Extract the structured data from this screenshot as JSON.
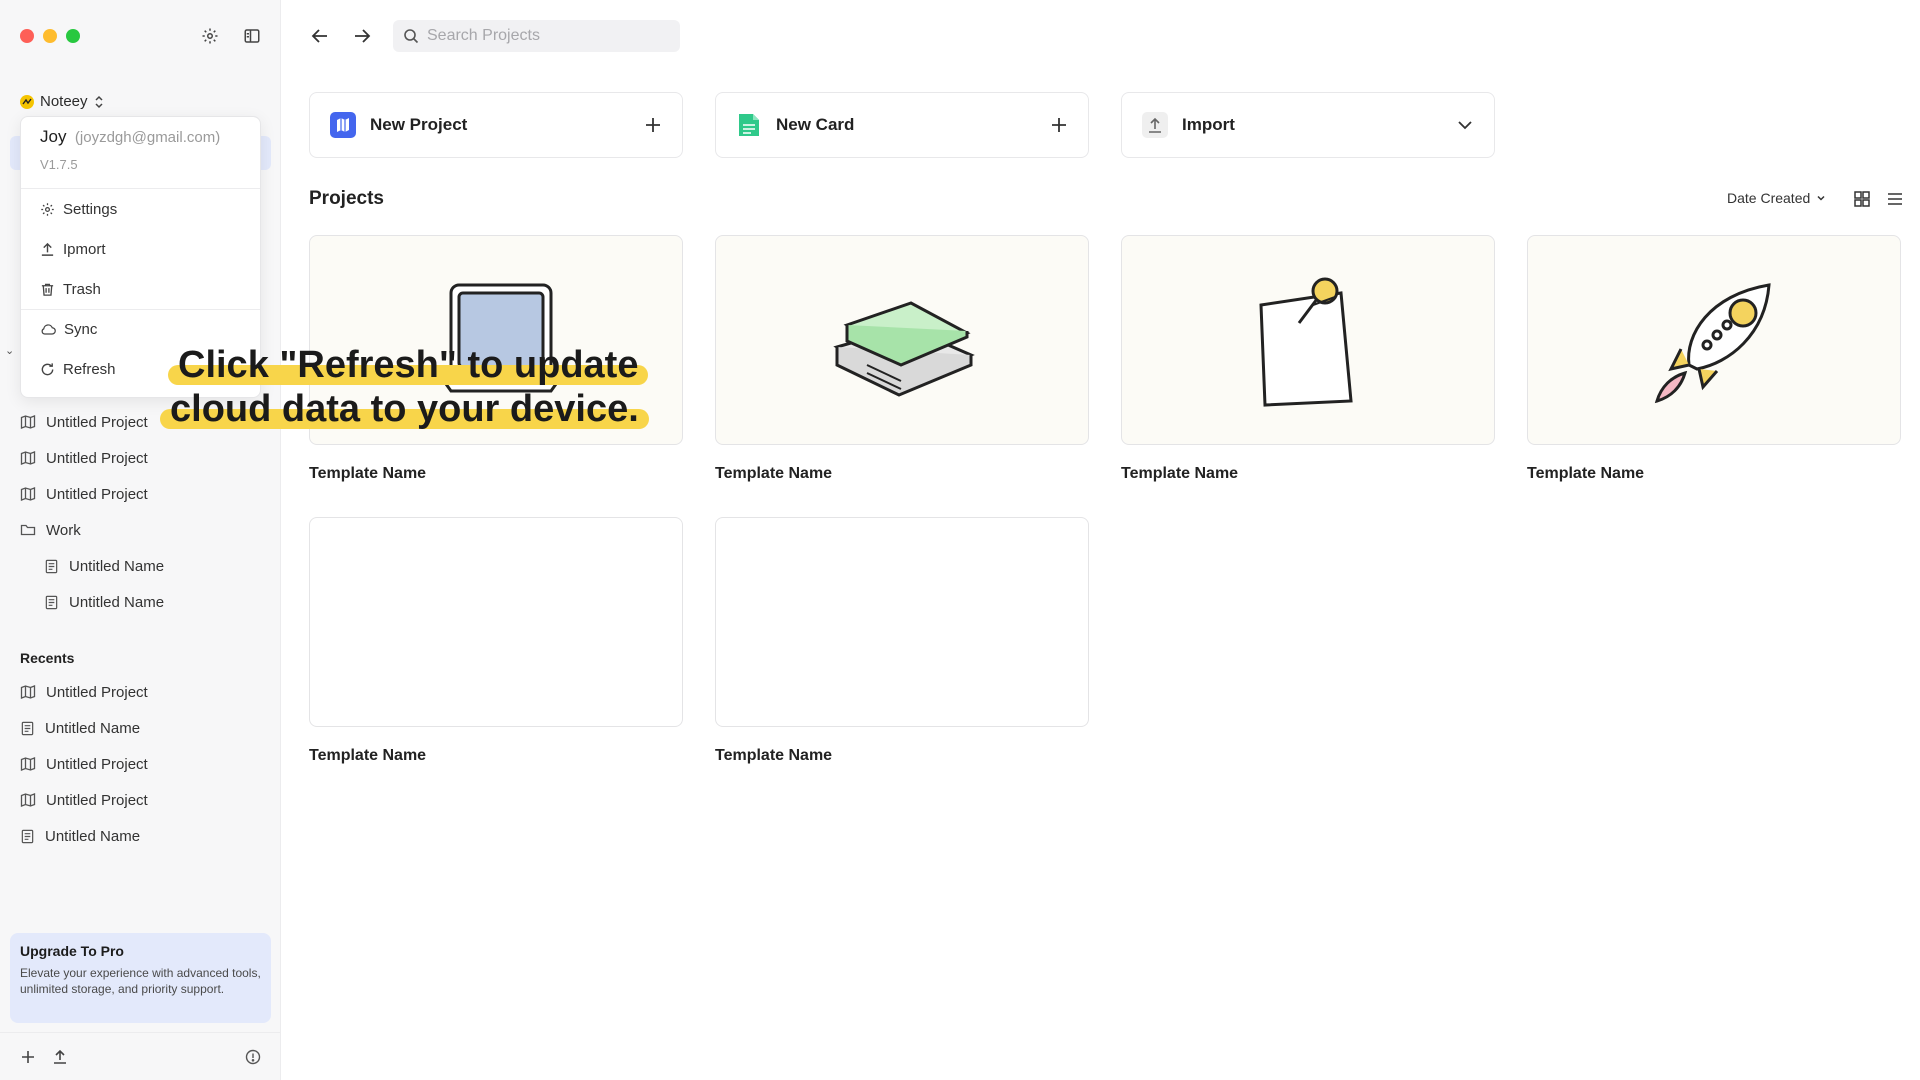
{
  "window": {
    "controls": [
      "close",
      "minimize",
      "zoom"
    ]
  },
  "sidebar": {
    "workspace_name": "Noteey",
    "tree": [
      {
        "icon": "map-icon",
        "label": "Untitled Project",
        "sub": false
      },
      {
        "icon": "map-icon",
        "label": "Untitled Project",
        "sub": false
      },
      {
        "icon": "map-icon",
        "label": "Untitled Project",
        "sub": false
      },
      {
        "icon": "folder-icon",
        "label": "Work",
        "sub": false
      },
      {
        "icon": "doc-icon",
        "label": "Untitled Name",
        "sub": true
      },
      {
        "icon": "doc-icon",
        "label": "Untitled Name",
        "sub": true
      }
    ],
    "recents_label": "Recents",
    "recents": [
      {
        "icon": "map-icon",
        "label": "Untitled Project"
      },
      {
        "icon": "doc-icon",
        "label": "Untitled Name"
      },
      {
        "icon": "map-icon",
        "label": "Untitled Project"
      },
      {
        "icon": "map-icon",
        "label": "Untitled Project"
      },
      {
        "icon": "doc-icon",
        "label": "Untitled Name"
      }
    ],
    "upgrade": {
      "title": "Upgrade To Pro",
      "body": "Elevate your experience with advanced tools, unlimited storage, and priority support."
    }
  },
  "dropdown": {
    "user_name": "Joy",
    "user_email": "(joyzdgh@gmail.com)",
    "version": "V1.7.5",
    "items": [
      {
        "icon": "gear-icon",
        "label": "Settings"
      },
      {
        "icon": "upload-icon",
        "label": "Ipmort"
      },
      {
        "icon": "trash-icon",
        "label": "Trash"
      },
      {
        "icon": "cloud-icon",
        "label": "Sync"
      },
      {
        "icon": "refresh-icon",
        "label": "Refresh"
      }
    ]
  },
  "callout": {
    "line1": "Click \"Refresh\" to update",
    "line2": "cloud data to your device."
  },
  "topbar": {
    "search_placeholder": "Search Projects"
  },
  "actions": {
    "new_project": "New Project",
    "new_card": "New Card",
    "import": "Import"
  },
  "projects": {
    "title": "Projects",
    "sort_label": "Date Created",
    "templates": [
      {
        "name": "Template Name",
        "art": "laptop"
      },
      {
        "name": "Template Name",
        "art": "books"
      },
      {
        "name": "Template Name",
        "art": "note-pin"
      },
      {
        "name": "Template Name",
        "art": "rocket"
      },
      {
        "name": "Template Name",
        "art": "blank"
      },
      {
        "name": "Template Name",
        "art": "blank"
      }
    ]
  },
  "colors": {
    "accent_blue": "#4466ee",
    "accent_green": "#2fc98a",
    "highlight_yellow": "#f8d54a",
    "upgrade_bg": "#e3e9fb"
  }
}
